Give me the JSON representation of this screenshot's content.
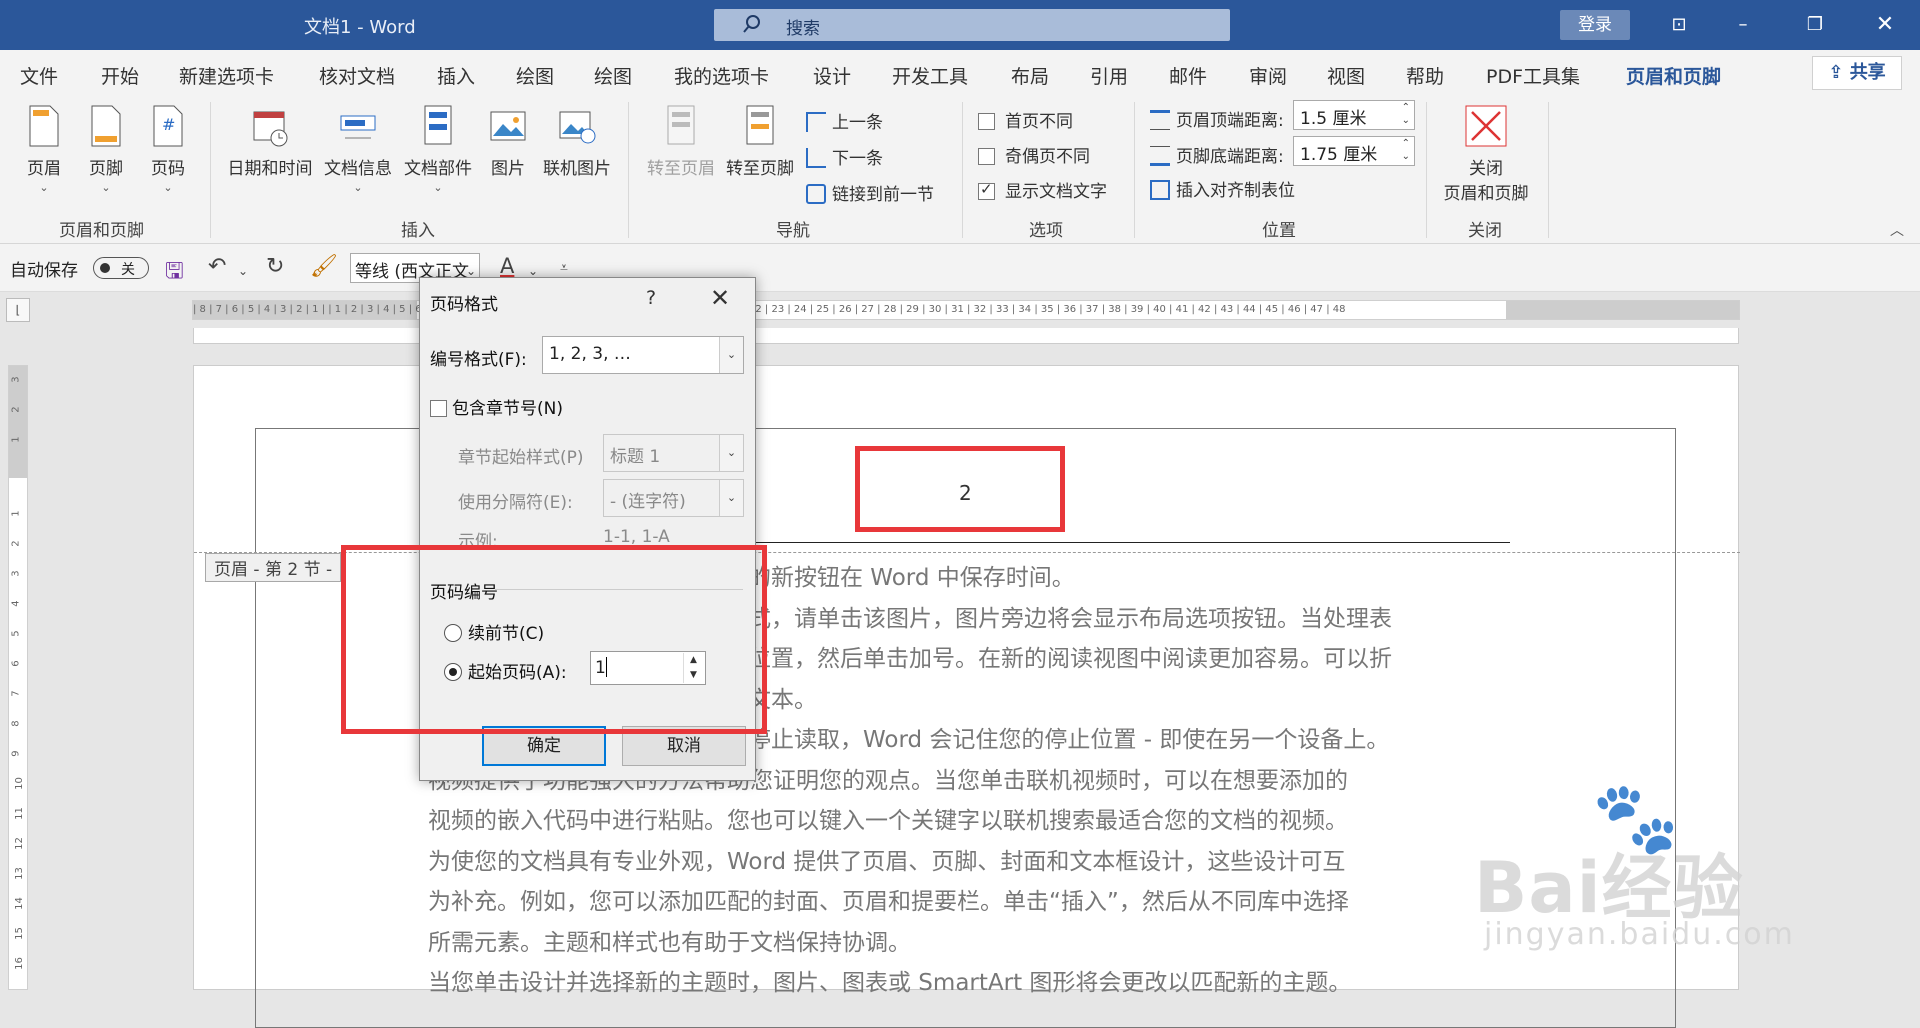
{
  "title_bar": {
    "doc_title": "文档1  -  Word",
    "search_placeholder": "搜索",
    "login": "登录"
  },
  "menu": {
    "items": [
      "文件",
      "开始",
      "新建选项卡",
      "核对文档",
      "插入",
      "绘图",
      "绘图",
      "我的选项卡",
      "设计",
      "开发工具",
      "布局",
      "引用",
      "邮件",
      "审阅",
      "视图",
      "帮助",
      "PDF工具集",
      "页眉和页脚"
    ],
    "active_index": 17,
    "share": "共享"
  },
  "ribbon": {
    "header_footer_group": {
      "label": "页眉和页脚",
      "buttons": [
        "页眉",
        "页脚",
        "页码"
      ]
    },
    "insert_group": {
      "label": "插入",
      "buttons": [
        "日期和时间",
        "文档信息",
        "文档部件",
        "图片",
        "联机图片"
      ]
    },
    "nav_group": {
      "label": "导航",
      "goto_header": "转至页眉",
      "goto_footer": "转至页脚",
      "prev": "上一条",
      "next": "下一条",
      "link_prev": "链接到前一节"
    },
    "options_group": {
      "label": "选项",
      "first_page": "首页不同",
      "odd_even": "奇偶页不同",
      "show_text": "显示文档文字",
      "show_text_checked": true
    },
    "position_group": {
      "label": "位置",
      "header_top_label": "页眉顶端距离:",
      "header_top_value": "1.5 厘米",
      "footer_bottom_label": "页脚底端距离:",
      "footer_bottom_value": "1.75 厘米",
      "insert_align_tab": "插入对齐制表位"
    },
    "close_group": {
      "label": "关闭",
      "close_button": "关闭\n页眉和页脚",
      "close_line1": "关闭",
      "close_line2": "页眉和页脚"
    }
  },
  "qat": {
    "autosave": "自动保存",
    "autosave_state": "关",
    "font": "等线 (西文正文"
  },
  "ruler": {
    "h_labels": "| 8 | 7 | 6 | 5 | 4 | 3 | 2 | 1 |   | 1 | 2 | 3 | 4 | 5 | 6 | 7 | 8 | 9 | 10 | 11 | 12 | 13 | 14 | 15 | 16 | 17 | 18 | 19 | 20 | 21 | 22 | 23 | 24 | 25 | 26 | 27 | 28 | 29 | 30 | 31 | 32 | 33 | 34 | 35 | 36 | 37 | 38 | 39 | 40 | 41 | 42 | 43 | 44 | 45 | 46 | 47 | 48",
    "v_labels": [
      "3",
      "2",
      "1",
      "",
      "1",
      "2",
      "3",
      "4",
      "5",
      "6",
      "7",
      "8",
      "9",
      "10",
      "11",
      "12",
      "13",
      "14",
      "15",
      "16"
    ]
  },
  "document": {
    "header_tag": "页眉 - 第 2 节 -",
    "page_number": "2",
    "paragraphs": [
      "的新按钮在  Word  中保存时间。",
      "式，请单击该图片，图片旁边将会显示布局选项按钮。当处理表",
      "位置，然后单击加号。在新的阅读视图中阅读更加容易。可以折",
      "文本。",
      "停止读取，Word  会记住您的停止位置  -  即使在另一个设备上。",
      "视频提供了功能强大的方法帮助您证明您的观点。当您单击联机视频时，可以在想要添加的",
      "视频的嵌入代码中进行粘贴。您也可以键入一个关键字以联机搜索最适合您的文档的视频。",
      "为使您的文档具有专业外观，Word  提供了页眉、页脚、封面和文本框设计，这些设计可互",
      "为补充。例如，您可以添加匹配的封面、页眉和提要栏。单击“插入”，然后从不同库中选择",
      "所需元素。主题和样式也有助于文档保持协调。",
      "当您单击设计并选择新的主题时，图片、图表或  SmartArt  图形将会更改以匹配新的主题。"
    ]
  },
  "dialog": {
    "title": "页码格式",
    "help": "?",
    "number_format_label": "编号格式(F):",
    "number_format_value": "1, 2, 3, …",
    "include_chapter": "包含章节号(N)",
    "chapter_style_label": "章节起始样式(P)",
    "chapter_style_value": "标题 1",
    "separator_label": "使用分隔符(E):",
    "separator_value": "-  (连字符)",
    "example_label": "示例:",
    "example_value": "1-1, 1-A",
    "numbering_section": "页码编号",
    "continue_label": "续前节(C)",
    "start_at_label": "起始页码(A):",
    "start_at_value": "1",
    "start_at_selected": true,
    "ok": "确定",
    "cancel": "取消"
  },
  "watermark": {
    "brand": "Bai",
    "brand_cn": "经验",
    "url": "jingyan.baidu.com"
  },
  "colors": {
    "accent": "#2b579a",
    "highlight": "#e8373a"
  }
}
